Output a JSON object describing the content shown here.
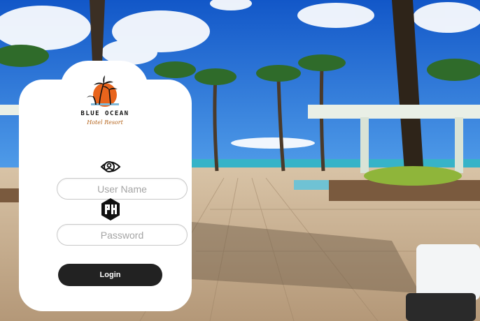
{
  "brand": {
    "name": "BLUE OCEAN",
    "tagline": "Hotel Resort",
    "logo_icon": "palm-sunset-logo",
    "accent": "#e8641c"
  },
  "form": {
    "username": {
      "placeholder": "User Name",
      "value": "",
      "icon": "user-eye-icon"
    },
    "password": {
      "placeholder": "Password",
      "value": "",
      "icon": "password-badge-icon"
    },
    "login_label": "Login"
  },
  "colors": {
    "card": "#ffffff",
    "button": "#222222",
    "sky": "#1e6fd9"
  }
}
